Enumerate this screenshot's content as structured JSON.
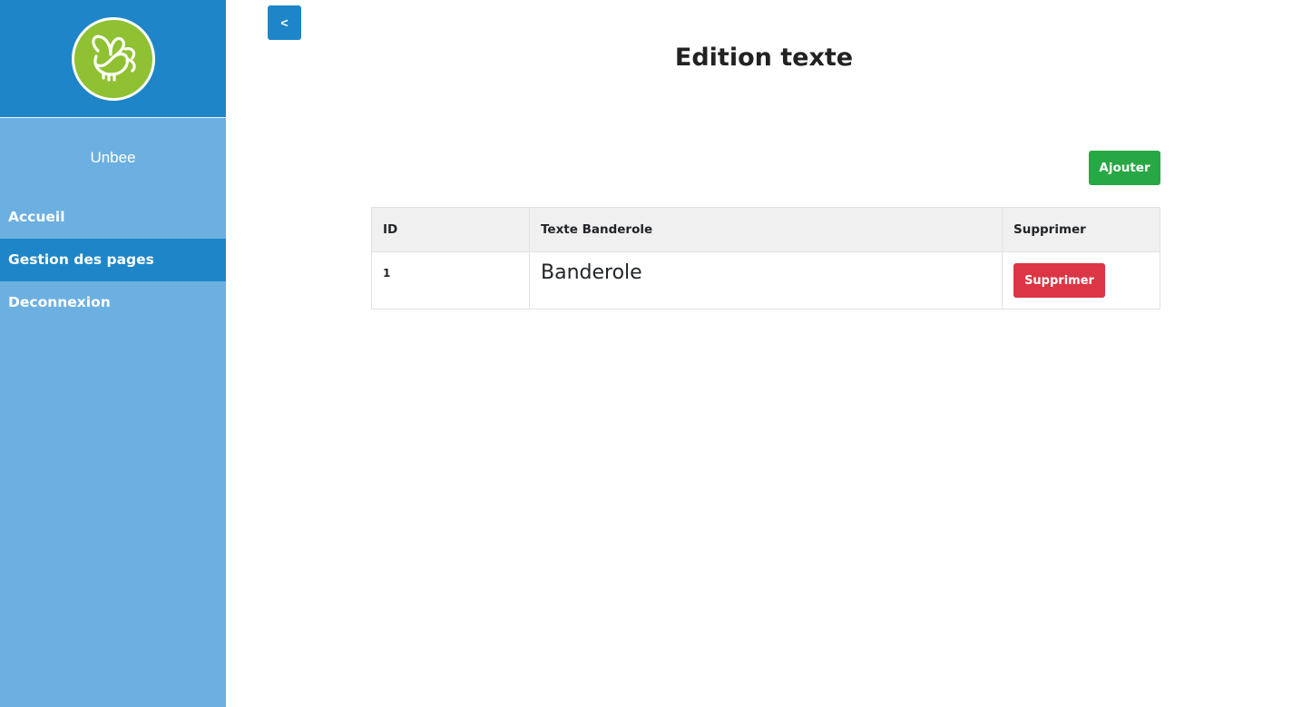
{
  "sidebar": {
    "brand": "Unbee",
    "items": [
      {
        "label": "Accueil",
        "active": false
      },
      {
        "label": "Gestion des pages",
        "active": true
      },
      {
        "label": "Deconnexion",
        "active": false
      }
    ]
  },
  "toggle": {
    "label": "<"
  },
  "page": {
    "title": "Edition texte"
  },
  "toolbar": {
    "add_label": "Ajouter"
  },
  "table": {
    "columns": [
      "ID",
      "Texte Banderole",
      "Supprimer"
    ],
    "rows": [
      {
        "id": "1",
        "text": "Banderole",
        "action_label": "Supprimer"
      }
    ]
  },
  "colors": {
    "sidebar_header": "#1e86c8",
    "sidebar_bg": "#6cb0e1",
    "logo_green": "#8fc132",
    "add_button": "#28a745",
    "delete_button": "#dc3545"
  }
}
